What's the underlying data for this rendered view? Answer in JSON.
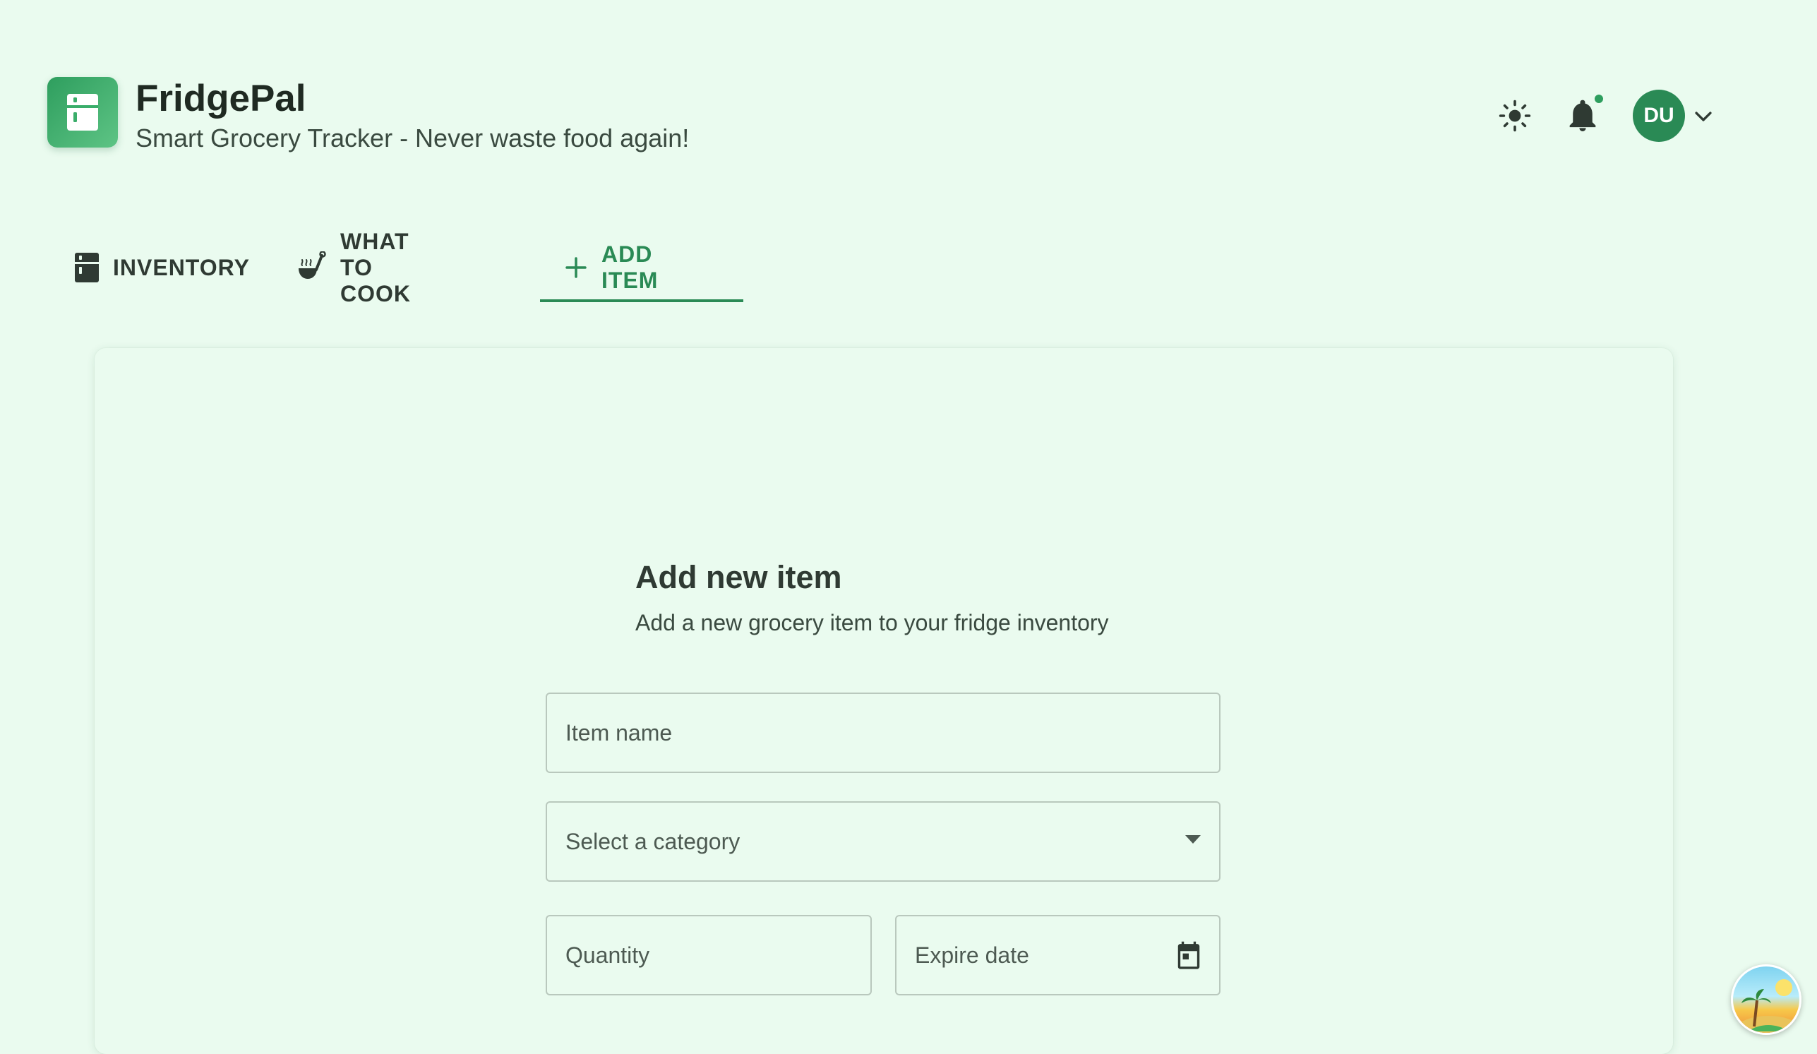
{
  "app": {
    "title": "FridgePal",
    "subtitle": "Smart Grocery Tracker - Never waste food again!"
  },
  "header": {
    "avatar_initials": "DU",
    "has_notification": true
  },
  "tabs": [
    {
      "label": "INVENTORY",
      "icon": "fridge-icon"
    },
    {
      "label": "WHAT TO COOK",
      "icon": "cooking-pot-icon"
    },
    {
      "label": "ADD ITEM",
      "icon": "plus-icon",
      "active": true
    }
  ],
  "form": {
    "title": "Add new item",
    "subtitle": "Add a new grocery item to your fridge inventory",
    "item_name_placeholder": "Item name",
    "category_placeholder": "Select a category",
    "quantity_placeholder": "Quantity",
    "expire_date_placeholder": "Expire date"
  },
  "colors": {
    "background": "#eafbef",
    "accent": "#2a8a55",
    "text": "#2f3a33"
  }
}
